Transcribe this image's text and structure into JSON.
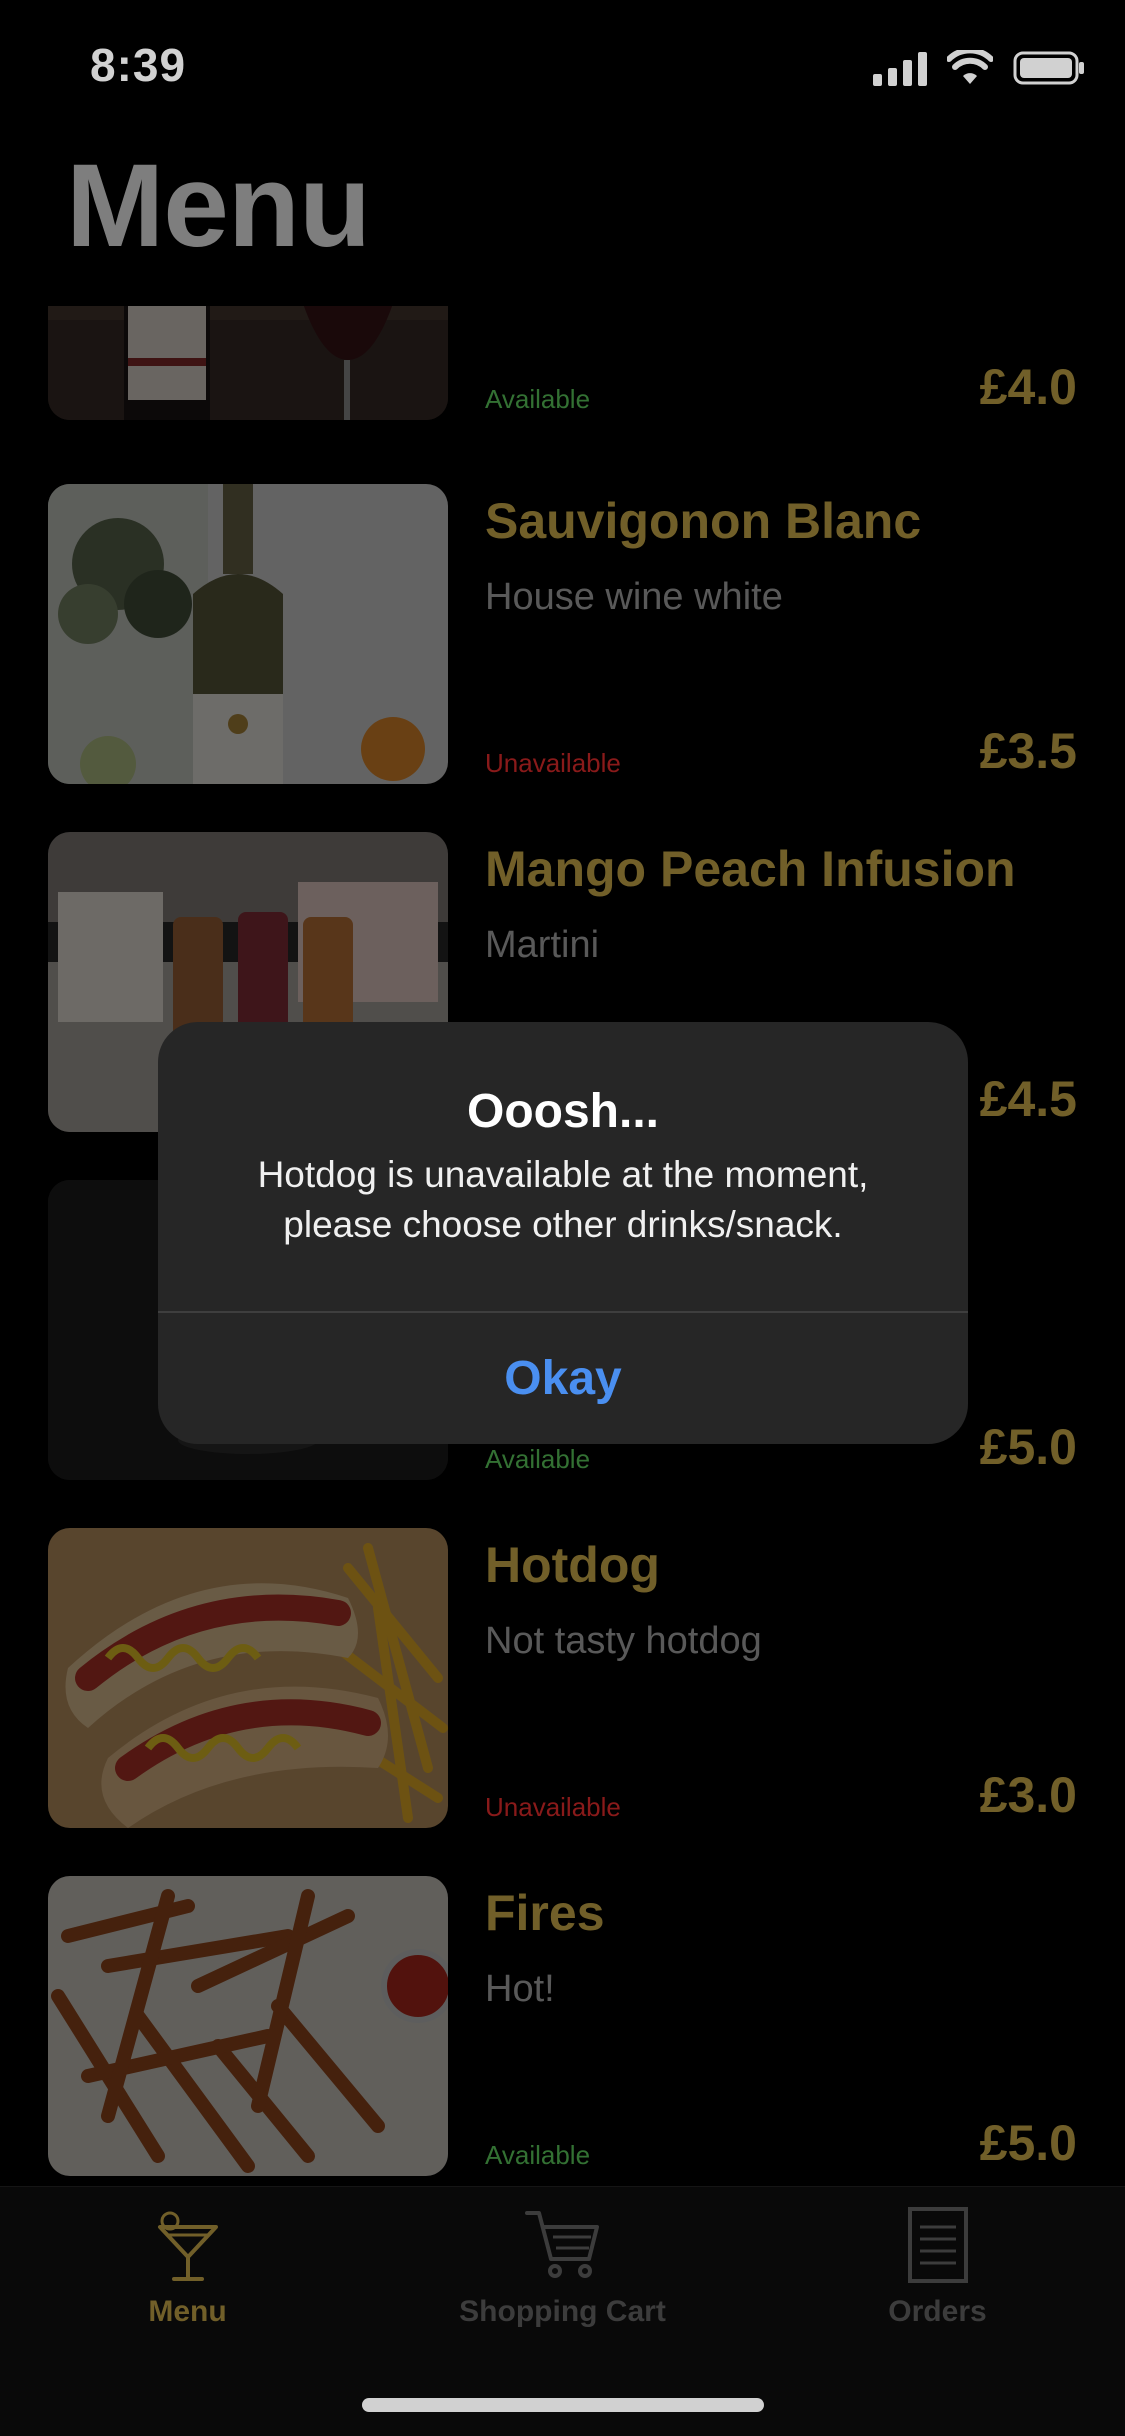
{
  "status_bar": {
    "time": "8:39"
  },
  "header": {
    "title": "Menu"
  },
  "menu_items": [
    {
      "name": "",
      "description": "",
      "status": "Available",
      "price": "£4.0",
      "image": "red-wine-bottle-photo"
    },
    {
      "name": "Sauvigonon Blanc",
      "description": "House wine white",
      "status": "Unavailable",
      "price": "£3.5",
      "image": "white-wine-bottle-photo"
    },
    {
      "name": "Mango Peach Infusion",
      "description": "Martini",
      "status": "",
      "price": "£4.5",
      "image": "tea-gift-box-photo"
    },
    {
      "name": "",
      "description": "",
      "status": "Available",
      "price": "£5.0",
      "image": "dark-drink-photo"
    },
    {
      "name": "Hotdog",
      "description": "Not tasty hotdog",
      "status": "Unavailable",
      "price": "£3.0",
      "image": "hotdog-photo"
    },
    {
      "name": "Fires",
      "description": "Hot!",
      "status": "Available",
      "price": "£5.0",
      "image": "sweet-potato-fries-photo"
    }
  ],
  "alert": {
    "title": "Ooosh...",
    "message": "Hotdog is unavailable at the moment, please choose other drinks/snack.",
    "button_label": "Okay"
  },
  "tab_bar": {
    "tabs": [
      {
        "label": "Menu",
        "icon": "cocktail-glass-icon",
        "active": true
      },
      {
        "label": "Shopping Cart",
        "icon": "shopping-cart-icon",
        "active": false
      },
      {
        "label": "Orders",
        "icon": "orders-list-icon",
        "active": false
      }
    ]
  },
  "colors": {
    "background": "#000000",
    "accent_gold": "#8a7433",
    "available_green": "#3f8a3f",
    "unavailable_red": "#a82020",
    "alert_button_blue": "#4a8ff0",
    "tab_inactive": "#4a4a4a"
  }
}
